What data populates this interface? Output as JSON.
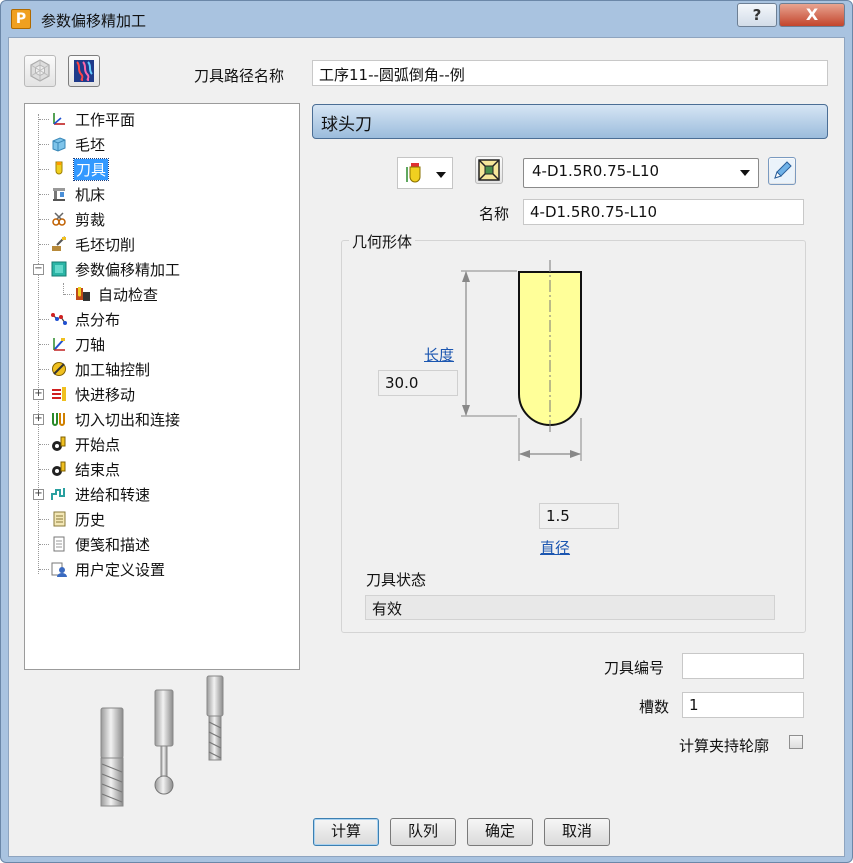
{
  "window": {
    "title": "参数偏移精加工",
    "logo_letter": "P",
    "help_label": "?",
    "close_label": "X"
  },
  "toolpath_name": {
    "label": "刀具路径名称",
    "value": "工序11--圆弧倒角--例"
  },
  "tree": {
    "items": [
      {
        "label": "工作平面",
        "icon": "workplane-icon"
      },
      {
        "label": "毛坯",
        "icon": "block-icon"
      },
      {
        "label": "刀具",
        "icon": "tool-icon"
      },
      {
        "label": "机床",
        "icon": "machine-icon"
      },
      {
        "label": "剪裁",
        "icon": "limit-icon"
      },
      {
        "label": "毛坯切削",
        "icon": "stock-cut-icon"
      },
      {
        "label": "参数偏移精加工",
        "icon": "strategy-icon"
      },
      {
        "label": "自动检查",
        "icon": "gouge-check-icon"
      },
      {
        "label": "点分布",
        "icon": "point-distribution-icon"
      },
      {
        "label": "刀轴",
        "icon": "tool-axis-icon"
      },
      {
        "label": "加工轴控制",
        "icon": "axis-control-icon"
      },
      {
        "label": "快进移动",
        "icon": "rapid-move-icon"
      },
      {
        "label": "切入切出和连接",
        "icon": "leads-links-icon"
      },
      {
        "label": "开始点",
        "icon": "start-point-icon"
      },
      {
        "label": "结束点",
        "icon": "end-point-icon"
      },
      {
        "label": "进给和转速",
        "icon": "feeds-speeds-icon"
      },
      {
        "label": "历史",
        "icon": "history-icon"
      },
      {
        "label": "便笺和描述",
        "icon": "notes-icon"
      },
      {
        "label": "用户定义设置",
        "icon": "user-settings-icon"
      }
    ],
    "selected": "刀具"
  },
  "section": {
    "title": "球头刀"
  },
  "tool": {
    "selected_tool": "4-D1.5R0.75-L10",
    "name_label": "名称",
    "name_value": "4-D1.5R0.75-L10"
  },
  "geometry": {
    "group_title": "几何形体",
    "length_label": "长度",
    "length_value": "30.0",
    "diameter_label": "直径",
    "diameter_value": "1.5",
    "tool_body_color": "#ffff99"
  },
  "state": {
    "label": "刀具状态",
    "value": "有效"
  },
  "fields": {
    "tool_number_label": "刀具编号",
    "tool_number_value": "",
    "flutes_label": "槽数",
    "flutes_value": "1",
    "holder_profile_label": "计算夹持轮廓"
  },
  "buttons": {
    "calculate": "计算",
    "queue": "队列",
    "ok": "确定",
    "cancel": "取消"
  },
  "colors": {
    "selection": "#3399ff",
    "header_gradient_top": "#d6e5f4",
    "header_gradient_bottom": "#9bbcdc"
  }
}
